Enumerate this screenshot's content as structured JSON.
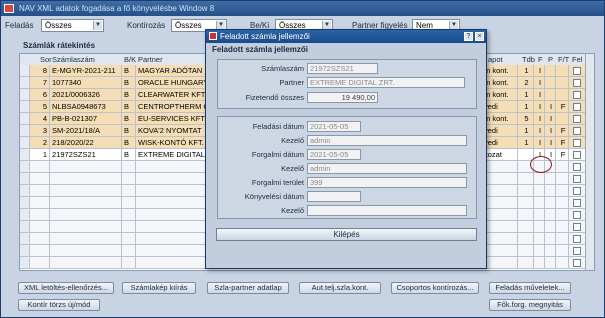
{
  "window": {
    "title": "NAV XML adatok fogadása a fő könyvelésbe Window 8"
  },
  "filters": {
    "feladas_label": "Feladás",
    "feladas_value": "Összes",
    "kontirozas_label": "Kontírozás",
    "kontirozas_value": "Összes",
    "beki_label": "Be/Ki",
    "beki_value": "Összes",
    "partner_figyeles_label": "Partner figyelés",
    "partner_figyeles_value": "Nem"
  },
  "group_title": "Számlák rátekintés",
  "columns": {
    "sor": "Sor",
    "szamlaszam": "Számlaszám",
    "bk": "B/K",
    "partner": "Partner",
    "allapot": "apot",
    "tdb": "Tdb",
    "f": "F",
    "p": "P",
    "ft": "F/T",
    "fel": "Fel"
  },
  "rows": [
    {
      "sor": "8",
      "szamlaszam": "E-MGYR-2021-211",
      "bk": "B",
      "partner": "MAGYAR ADÓTAN",
      "allapot": "m kont.",
      "tdb": "1",
      "f": "I",
      "p": "",
      "ft": "",
      "style": "orange"
    },
    {
      "sor": "7",
      "szamlaszam": "1077340",
      "bk": "B",
      "partner": "ORACLE HUNGARY",
      "allapot": "m kont.",
      "tdb": "2",
      "f": "I",
      "p": "",
      "ft": "",
      "style": "orange"
    },
    {
      "sor": "6",
      "szamlaszam": "2021/0006326",
      "bk": "B",
      "partner": "CLEARWATER KFT",
      "allapot": "m kont.",
      "tdb": "1",
      "f": "I",
      "p": "",
      "ft": "",
      "style": "orange"
    },
    {
      "sor": "5",
      "szamlaszam": "NLBSA0948673",
      "bk": "B",
      "partner": "CENTROPTHERM G",
      "allapot": "yedi",
      "tdb": "1",
      "f": "I",
      "p": "I",
      "ft": "F",
      "style": "orange"
    },
    {
      "sor": "4",
      "szamlaszam": "PB-B-021307",
      "bk": "B",
      "partner": "EU-SERVICES KFT",
      "allapot": "m kont.",
      "tdb": "5",
      "f": "I",
      "p": "I",
      "ft": "",
      "style": "orange"
    },
    {
      "sor": "3",
      "szamlaszam": "SM-2021/18/A",
      "bk": "B",
      "partner": "KOVA'2 NYOMTAT",
      "allapot": "yedi",
      "tdb": "1",
      "f": "I",
      "p": "I",
      "ft": "F",
      "style": "orange"
    },
    {
      "sor": "2",
      "szamlaszam": "218/2020/22",
      "bk": "B",
      "partner": "WISK-KONTÓ KFT.",
      "allapot": "yedi",
      "tdb": "1",
      "f": "I",
      "p": "I",
      "ft": "F",
      "style": "orange"
    },
    {
      "sor": "1",
      "szamlaszam": "21972SZS21",
      "bk": "B",
      "partner": "EXTREME DIGITAL",
      "allapot": "ltozat",
      "tdb": "",
      "f": "I",
      "p": "I",
      "ft": "F",
      "style": "white"
    }
  ],
  "buttons": {
    "xml_letoltes": "XML letöltés-ellenőrzés...",
    "szamlakep": "Számlakép kiírás",
    "szla_partner": "Szla-partner adatlap",
    "aut_telj": "Aut.telj.szla.kont.",
    "csoportos": "Csoportos kontírozás...",
    "feladas_muveletek": "Feladás műveletek...",
    "kontir_torzs": "Kontír törzs új/mód",
    "fok_forg": "Fők.forg. megnyitás"
  },
  "dialog": {
    "title": "Feladott számla jellemzői",
    "header": "Feladott számla jellemzői",
    "szamlaszam_label": "Számlaszám",
    "szamlaszam_value": "21972SZS21",
    "partner_label": "Partner",
    "partner_value": "EXTREME DIGITAL ZRT.",
    "fizetendo_label": "Fizetendő összes",
    "fizetendo_value": "19 490,00",
    "feladasi_datum_label": "Feladási dátum",
    "feladasi_datum_value": "2021-05-05",
    "kezelo1_label": "Kezelő",
    "kezelo1_value": "admin",
    "forgalmi_datum1_label": "Forgalmi dátum",
    "forgalmi_datum1_value": "2021-05-05",
    "kezelo2_label": "Kezelő",
    "kezelo2_value": "admin",
    "forgalmi_terulet_label": "Forgalmi terület",
    "forgalmi_terulet_value": "399",
    "konyvelesi_datum_label": "Könyvelési dátum",
    "konyvelesi_datum_value": "",
    "kezelo3_label": "Kezelő",
    "kezelo3_value": "",
    "kilepes": "Kilépés"
  }
}
